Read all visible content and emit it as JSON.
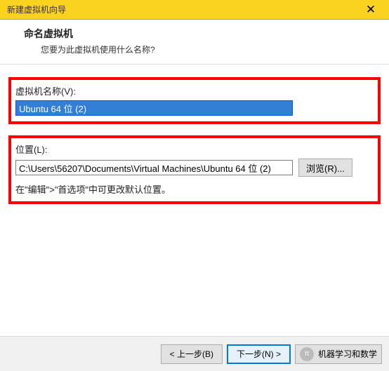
{
  "titlebar": {
    "title": "新建虚拟机向导"
  },
  "wizard": {
    "heading": "命名虚拟机",
    "subheading": "您要为此虚拟机使用什么名称?"
  },
  "name_section": {
    "label": "虚拟机名称(V):",
    "value": "Ubuntu 64 位 (2)"
  },
  "location_section": {
    "label": "位置(L):",
    "value": "C:\\Users\\56207\\Documents\\Virtual Machines\\Ubuntu 64 位 (2)",
    "browse": "浏览(R)...",
    "hint": "在\"编辑\">\"首选项\"中可更改默认位置。"
  },
  "footer": {
    "back": "< 上一步(B)",
    "next": "下一步(N) >",
    "watermark": "机器学习和数学"
  }
}
